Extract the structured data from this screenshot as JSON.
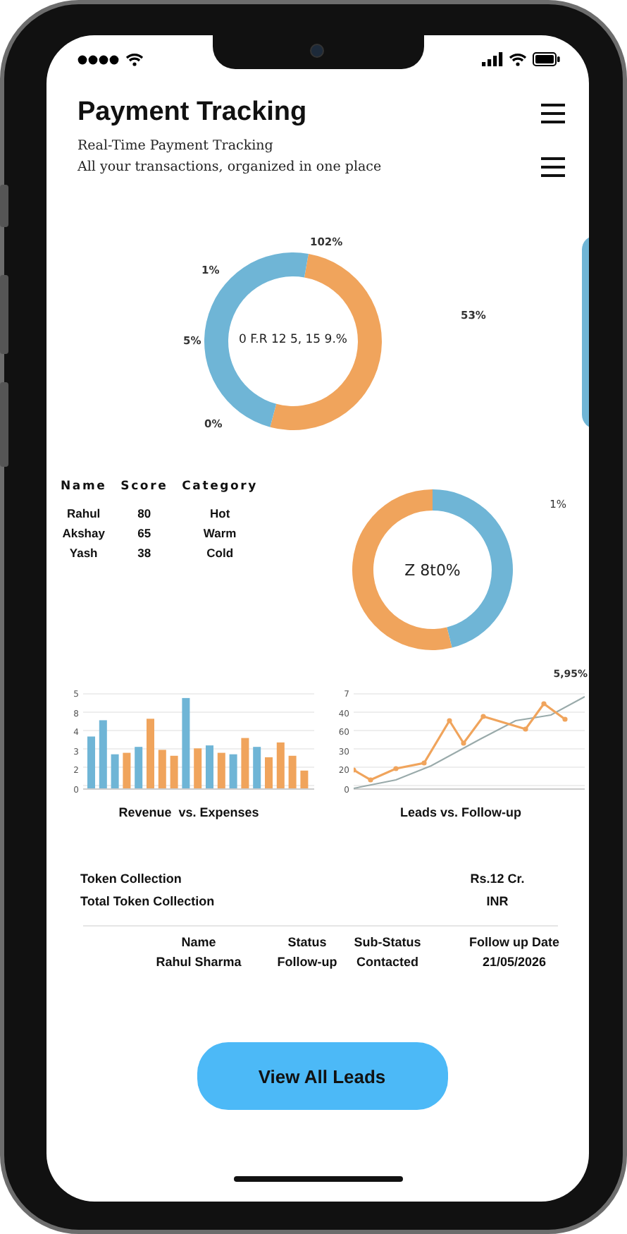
{
  "header": {
    "title": "Payment Tracking",
    "subtitle": "Real-Time Payment Tracking",
    "tagline": "All your transactions, organized in one place"
  },
  "donut_main": {
    "center_text": "0 F.R 12 5, 15 9.%",
    "labels": [
      "102%",
      "1%",
      "5%",
      "0%",
      "53%"
    ]
  },
  "lead_scores": {
    "columns": [
      "Name",
      "Score",
      "Category"
    ],
    "rows": [
      [
        "Rahul",
        "80",
        "Hot"
      ],
      [
        "Akshay",
        "65",
        "Warm"
      ],
      [
        "Yash",
        "38",
        "Cold"
      ]
    ]
  },
  "donut_small": {
    "center_text": "Z 8t0%",
    "label": "1%"
  },
  "bar_chart": {
    "title": "Revenue  vs. Expenses",
    "axis_labels": [
      "5",
      "8",
      "4",
      "3",
      "2",
      "0"
    ]
  },
  "line_chart": {
    "title": "Leads vs. Follow-up",
    "corner_label": "5,95%",
    "axis_labels": [
      "7",
      "40",
      "60",
      "30",
      "20",
      "0"
    ]
  },
  "token": [
    {
      "label": "Token Collection",
      "value": "Rs.12 Cr."
    },
    {
      "label": "Total Token Collection",
      "value": "INR"
    }
  ],
  "leads": {
    "columns": [
      "Name",
      "Status",
      "Sub-Status",
      "Follow up Date"
    ],
    "rows": [
      [
        "Rahul Sharma",
        "Follow-up",
        "Contacted",
        "21/05/2026"
      ]
    ]
  },
  "button": "View All Leads"
}
